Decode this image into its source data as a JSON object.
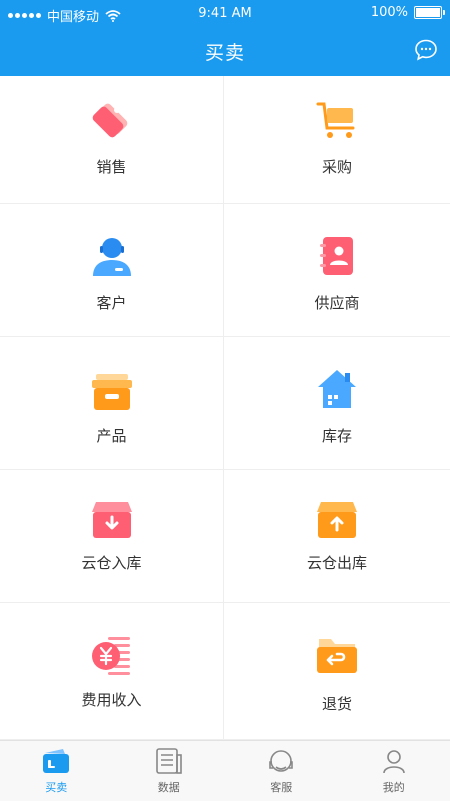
{
  "status": {
    "carrier": "中国移动",
    "time": "9:41 AM",
    "battery": "100%"
  },
  "header": {
    "title": "买卖"
  },
  "menu": {
    "items": [
      {
        "label": "销售",
        "icon": "tag-icon"
      },
      {
        "label": "采购",
        "icon": "cart-icon"
      },
      {
        "label": "客户",
        "icon": "customer-icon"
      },
      {
        "label": "供应商",
        "icon": "supplier-book-icon"
      },
      {
        "label": "产品",
        "icon": "product-box-icon"
      },
      {
        "label": "库存",
        "icon": "warehouse-house-icon"
      },
      {
        "label": "云仓入库",
        "icon": "box-download-icon"
      },
      {
        "label": "云仓出库",
        "icon": "box-upload-icon"
      },
      {
        "label": "费用收入",
        "icon": "yuan-coin-icon"
      },
      {
        "label": "退货",
        "icon": "return-folder-icon"
      }
    ]
  },
  "tabbar": {
    "tabs": [
      {
        "label": "买卖",
        "active": true
      },
      {
        "label": "数据",
        "active": false
      },
      {
        "label": "客服",
        "active": false
      },
      {
        "label": "我的",
        "active": false
      }
    ]
  },
  "colors": {
    "primary": "#1a9bf0",
    "orange": "#ff9a1a",
    "pink": "#ff5f73"
  }
}
